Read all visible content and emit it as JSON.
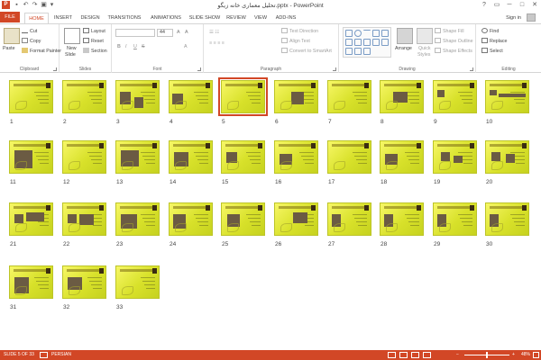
{
  "window": {
    "title": "تحلیل معماری خانه زیگو.pptx - PowerPoint",
    "app_icon": "P",
    "controls": [
      "?",
      "▭",
      "─",
      "□",
      "✕"
    ]
  },
  "quick_access": [
    "save-icon",
    "undo-icon",
    "redo-icon",
    "slideshow-icon",
    "customize-icon"
  ],
  "tabs": [
    "FILE",
    "HOME",
    "INSERT",
    "DESIGN",
    "TRANSITIONS",
    "ANIMATIONS",
    "SLIDE SHOW",
    "REVIEW",
    "VIEW",
    "ADD-INS"
  ],
  "active_tab": "HOME",
  "signin": "Sign in",
  "ribbon": {
    "clipboard": {
      "label": "Clipboard",
      "paste": "Paste",
      "cut": "Cut",
      "copy": "Copy",
      "format_painter": "Format Painter"
    },
    "slides": {
      "label": "Slides",
      "new_slide": "New",
      "new_slide2": "Slide",
      "layout": "Layout",
      "reset": "Reset",
      "section": "Section"
    },
    "font": {
      "label": "Font",
      "size": "44",
      "bold": "B",
      "italic": "I",
      "underline": "U",
      "strike": "S",
      "clear": "A"
    },
    "paragraph": {
      "label": "Paragraph",
      "text_direction": "Text Direction",
      "align_text": "Align Text",
      "smartart": "Convert to SmartArt"
    },
    "drawing": {
      "label": "Drawing",
      "arrange": "Arrange",
      "quick_styles": "Quick",
      "quick_styles2": "Styles",
      "shape_fill": "Shape Fill",
      "shape_outline": "Shape Outline",
      "shape_effects": "Shape Effects"
    },
    "editing": {
      "label": "Editing",
      "find": "Find",
      "replace": "Replace",
      "select": "Select"
    }
  },
  "slides": [
    "1",
    "2",
    "3",
    "4",
    "5",
    "6",
    "7",
    "8",
    "9",
    "10",
    "11",
    "12",
    "13",
    "14",
    "15",
    "16",
    "17",
    "18",
    "19",
    "20",
    "21",
    "22",
    "23",
    "24",
    "25",
    "26",
    "27",
    "28",
    "29",
    "30",
    "31",
    "32",
    "33"
  ],
  "selected_slide": "5",
  "status": {
    "slide_of": "SLIDE 5 OF 33",
    "language": "PERSIAN",
    "zoom": "48%",
    "zoom_minus": "−",
    "zoom_plus": "+"
  },
  "colors": {
    "accent": "#d24726",
    "slide_bg": "#d8e12a"
  }
}
